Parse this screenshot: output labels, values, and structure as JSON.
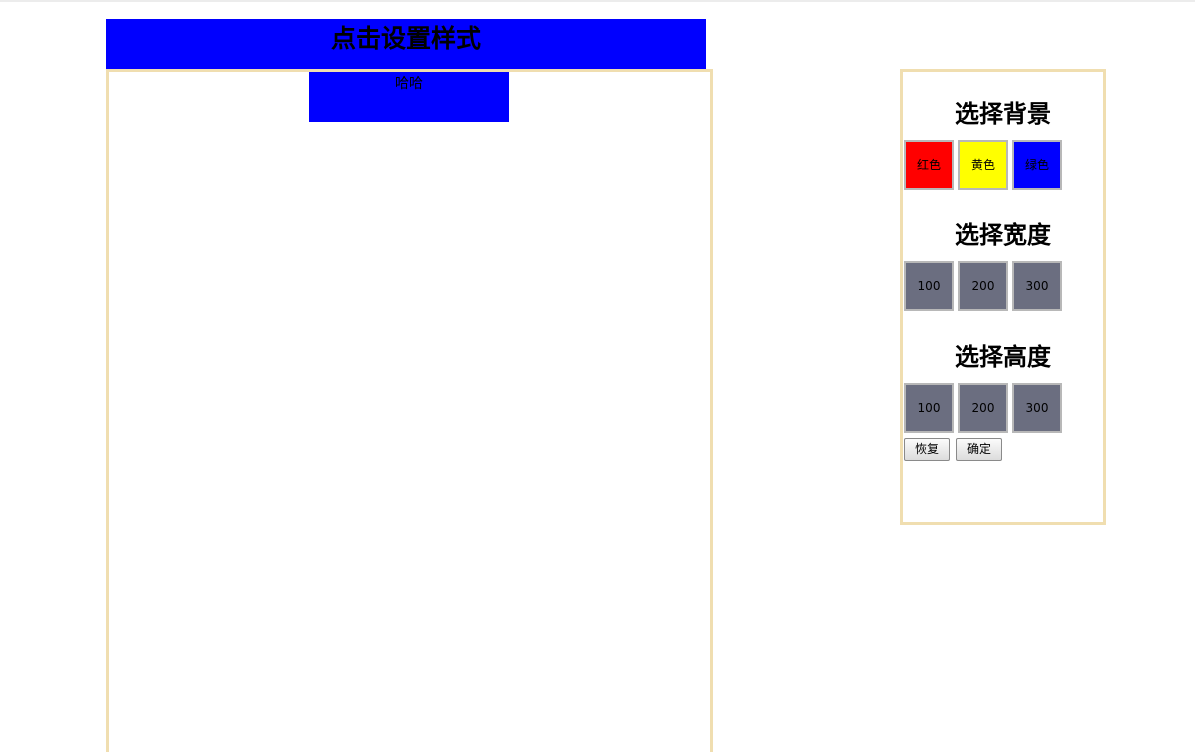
{
  "title": "点击设置样式",
  "target_box": {
    "text": "哈哈",
    "background": "#0000ff"
  },
  "panel": {
    "background_section": {
      "heading": "选择背景",
      "options": [
        {
          "label": "红色",
          "color": "#ff0000"
        },
        {
          "label": "黄色",
          "color": "#ffff00"
        },
        {
          "label": "绿色",
          "color": "#0000ff"
        }
      ]
    },
    "width_section": {
      "heading": "选择宽度",
      "options": [
        {
          "label": "100"
        },
        {
          "label": "200"
        },
        {
          "label": "300"
        }
      ]
    },
    "height_section": {
      "heading": "选择高度",
      "options": [
        {
          "label": "100"
        },
        {
          "label": "200"
        },
        {
          "label": "300"
        }
      ]
    },
    "actions": {
      "reset_label": "恢复",
      "confirm_label": "确定"
    }
  },
  "colors": {
    "accent_blue": "#0000ff",
    "border_wheat": "#f0deb0",
    "option_gray": "#6b6e80"
  }
}
